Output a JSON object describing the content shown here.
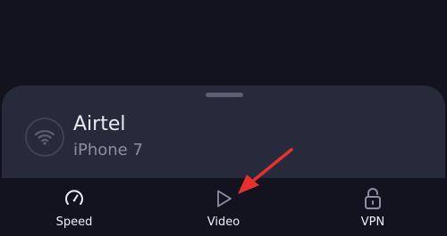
{
  "sheet": {
    "network_name": "Airtel",
    "device_name": "iPhone 7",
    "network_icon": "wifi-icon"
  },
  "tabs": [
    {
      "label": "Speed",
      "icon": "speedometer-icon"
    },
    {
      "label": "Video",
      "icon": "play-icon"
    },
    {
      "label": "VPN",
      "icon": "unlock-icon"
    }
  ],
  "colors": {
    "background": "#12131f",
    "sheet": "#262a3b",
    "annotation_arrow": "#e8312f"
  }
}
